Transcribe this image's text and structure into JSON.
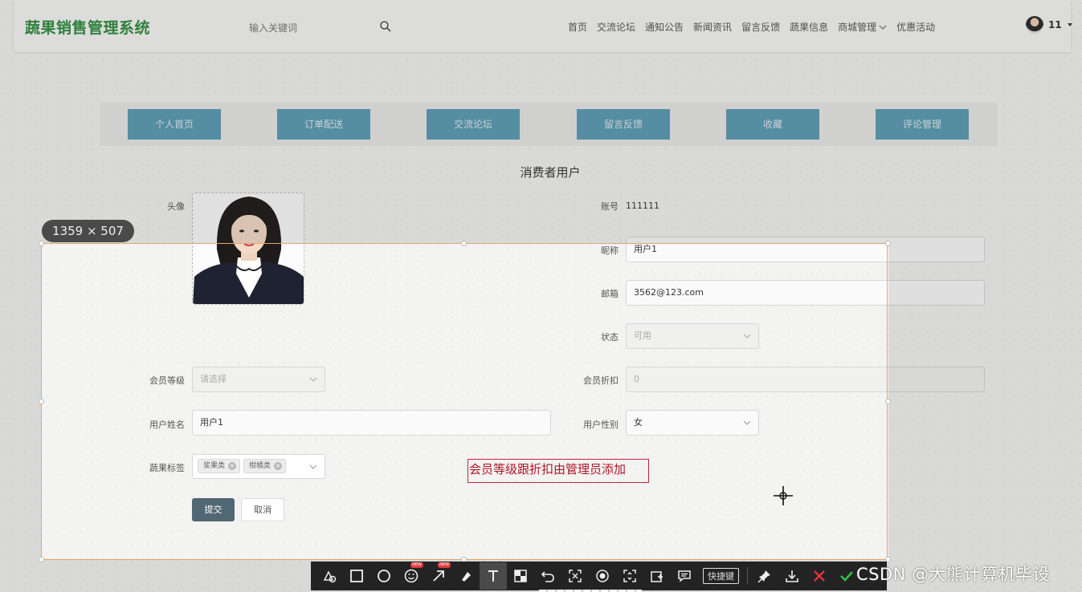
{
  "header": {
    "logo": "蔬果销售管理系统",
    "search_placeholder": "输入关键词",
    "nav": [
      "首页",
      "交流论坛",
      "通知公告",
      "新闻资讯",
      "留言反馈",
      "蔬果信息",
      "商城管理",
      "优惠活动"
    ],
    "user_name": "11"
  },
  "tabs": [
    "个人首页",
    "订单配送",
    "交流论坛",
    "留言反馈",
    "收藏",
    "评论管理"
  ],
  "form": {
    "title": "消费者用户",
    "avatar_label": "头像",
    "account_label": "账号",
    "account_value": "111111",
    "nickname_label": "昵称",
    "nickname_value": "用户1",
    "email_label": "邮箱",
    "email_value": "3562@123.com",
    "status_label": "状态",
    "status_value": "可用",
    "level_label": "会员等级",
    "level_placeholder": "请选择",
    "discount_label": "会员折扣",
    "discount_value": "0",
    "realname_label": "用户姓名",
    "realname_value": "用户1",
    "gender_label": "用户性别",
    "gender_value": "女",
    "tags_label": "蔬果标签",
    "tags": [
      "浆果类",
      "柑橘类"
    ],
    "submit_label": "提交",
    "cancel_label": "取消"
  },
  "annotation_text": "会员等级跟折扣由管理员添加",
  "screenshot_tool": {
    "size_label": "1359 × 507",
    "new_badge": "NEW",
    "shortcut_label": "快捷键",
    "icons": [
      "shape-icon",
      "rectangle-icon",
      "circle-icon",
      "emoji-icon",
      "arrow-icon",
      "marker-icon",
      "text-icon",
      "mosaic-icon",
      "undo-icon",
      "ocr-icon",
      "record-icon",
      "scroll-capture-icon",
      "pin-add-icon",
      "comment-icon",
      "pin-icon",
      "download-icon",
      "close-icon",
      "confirm-icon"
    ]
  },
  "watermark": "CSDN @大熊计算机毕设"
}
